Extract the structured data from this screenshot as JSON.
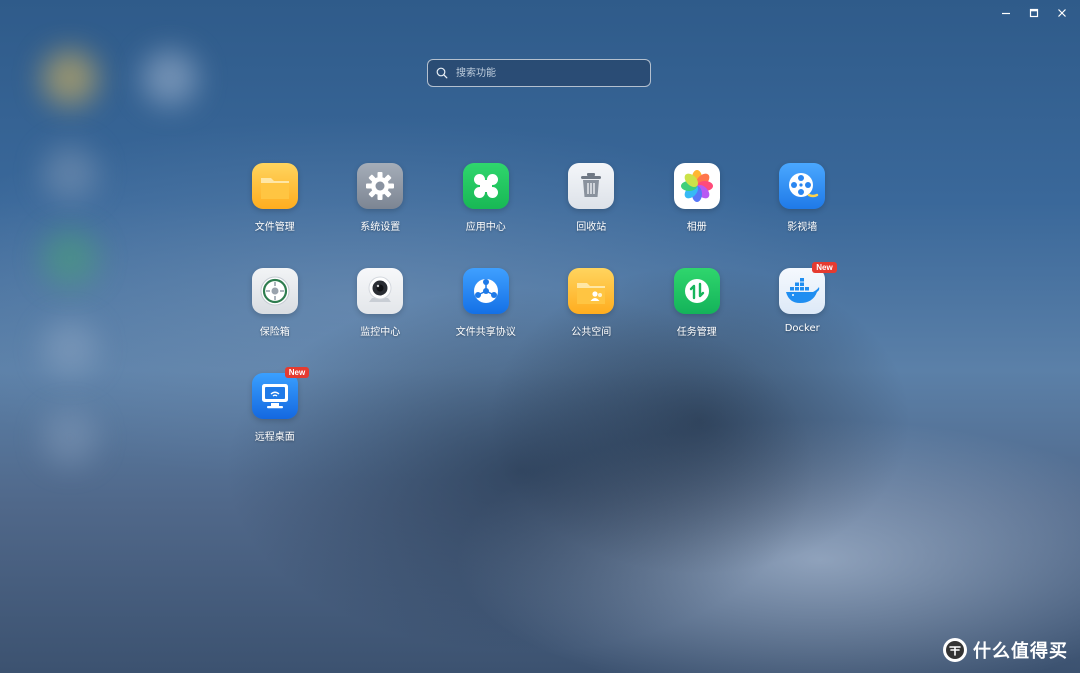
{
  "window": {
    "controls": [
      {
        "name": "minimize-icon"
      },
      {
        "name": "maximize-icon"
      },
      {
        "name": "close-icon"
      }
    ]
  },
  "search": {
    "placeholder": "搜索功能",
    "icon": "search-icon"
  },
  "apps": [
    {
      "label": "文件管理",
      "icon": "folder-icon",
      "badge": ""
    },
    {
      "label": "系统设置",
      "icon": "gear-icon",
      "badge": ""
    },
    {
      "label": "应用中心",
      "icon": "clover-icon",
      "badge": ""
    },
    {
      "label": "回收站",
      "icon": "trash-icon",
      "badge": ""
    },
    {
      "label": "相册",
      "icon": "photos-icon",
      "badge": ""
    },
    {
      "label": "影视墙",
      "icon": "film-reel-icon",
      "badge": ""
    },
    {
      "label": "保险箱",
      "icon": "safe-icon",
      "badge": ""
    },
    {
      "label": "监控中心",
      "icon": "camera-icon",
      "badge": ""
    },
    {
      "label": "文件共享协议",
      "icon": "network-share-icon",
      "badge": ""
    },
    {
      "label": "公共空间",
      "icon": "shared-folder-icon",
      "badge": ""
    },
    {
      "label": "任务管理",
      "icon": "task-arrows-icon",
      "badge": ""
    },
    {
      "label": "Docker",
      "icon": "docker-whale-icon",
      "badge": "New"
    },
    {
      "label": "远程桌面",
      "icon": "remote-desktop-icon",
      "badge": "New"
    }
  ],
  "watermark": {
    "text": "什么值得买",
    "icon": "smzdm-logo-icon"
  },
  "colors": {
    "badge": "#e53b30",
    "folder": "#ffb52e",
    "settings": "#8e98a6",
    "app_center": "#22c55e",
    "film": "#2f8cf5",
    "task": "#1fbf6a"
  }
}
